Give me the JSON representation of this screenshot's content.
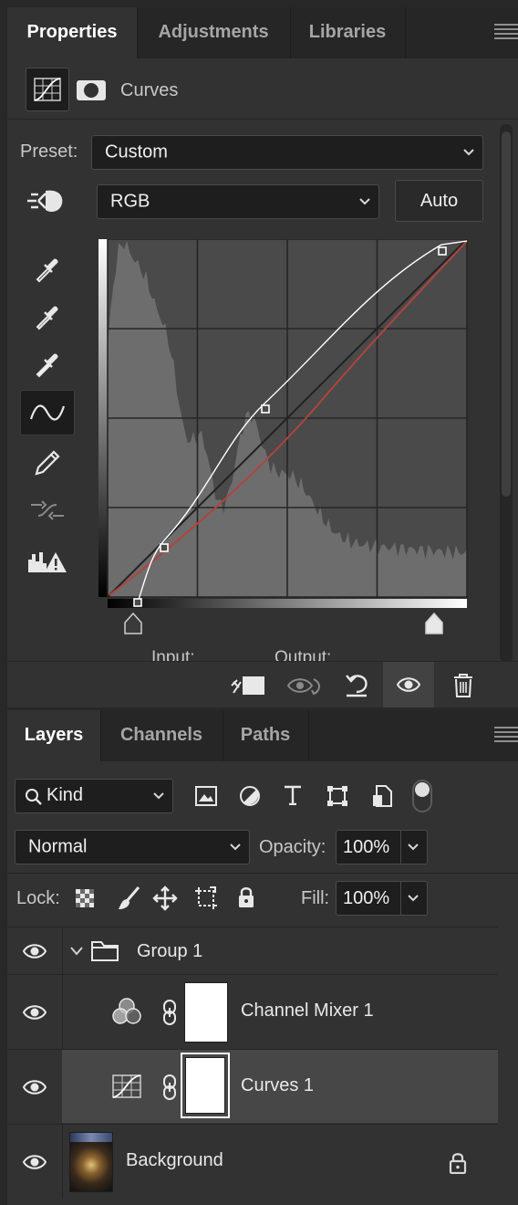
{
  "properties": {
    "tabs": [
      {
        "label": "Properties",
        "active": true
      },
      {
        "label": "Adjustments",
        "active": false
      },
      {
        "label": "Libraries",
        "active": false
      }
    ],
    "adjustment_title": "Curves",
    "preset_label": "Preset:",
    "preset_value": "Custom",
    "channel_value": "RGB",
    "auto_label": "Auto",
    "input_label": "Input:",
    "output_label": "Output:"
  },
  "layers_panel": {
    "tabs": [
      {
        "label": "Layers",
        "active": true
      },
      {
        "label": "Channels",
        "active": false
      },
      {
        "label": "Paths",
        "active": false
      }
    ],
    "filter_value": "Kind",
    "blend_mode": "Normal",
    "opacity_label": "Opacity:",
    "opacity_value": "100%",
    "lock_label": "Lock:",
    "fill_label": "Fill:",
    "fill_value": "100%",
    "layers": [
      {
        "name": "Group 1",
        "type": "group",
        "visible": true
      },
      {
        "name": "Channel Mixer 1",
        "type": "adjustment",
        "visible": true
      },
      {
        "name": "Curves 1",
        "type": "adjustment",
        "visible": true,
        "selected": true
      },
      {
        "name": "Background",
        "type": "image",
        "visible": true,
        "locked": true
      }
    ]
  },
  "colors": {
    "panel": "#323232",
    "tab_bar": "#262626",
    "selected_row": "#474747",
    "curve_red": "#b0443c"
  }
}
